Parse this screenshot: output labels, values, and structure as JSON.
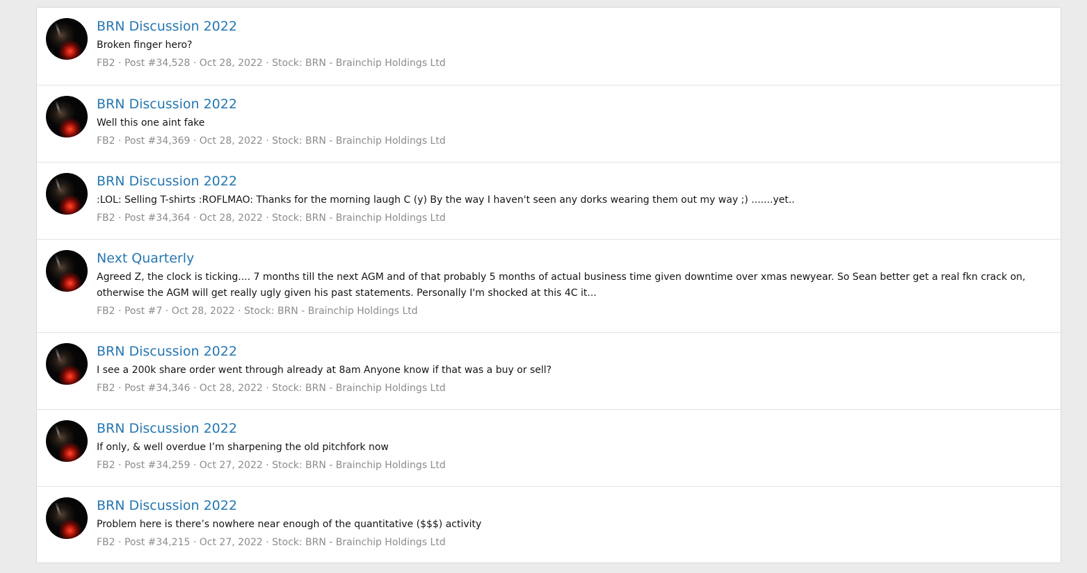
{
  "results": [
    {
      "title": "BRN Discussion 2022",
      "snippet": "Broken finger hero?",
      "author": "FB2",
      "post": "Post #34,528",
      "date": "Oct 28, 2022",
      "forum": "Stock: BRN - Brainchip Holdings Ltd"
    },
    {
      "title": "BRN Discussion 2022",
      "snippet": "Well this one aint fake",
      "author": "FB2",
      "post": "Post #34,369",
      "date": "Oct 28, 2022",
      "forum": "Stock: BRN - Brainchip Holdings Ltd"
    },
    {
      "title": "BRN Discussion 2022",
      "snippet": ":LOL: Selling T-shirts :ROFLMAO: Thanks for the morning laugh C (y) By the way I haven't seen any dorks wearing them out my way ;) .......yet..",
      "author": "FB2",
      "post": "Post #34,364",
      "date": "Oct 28, 2022",
      "forum": "Stock: BRN - Brainchip Holdings Ltd"
    },
    {
      "title": "Next Quarterly",
      "snippet": "Agreed Z, the clock is ticking.... 7 months till the next AGM and of that probably 5 months of actual business time given downtime over xmas newyear. So Sean better get a real fkn crack on, otherwise the AGM will get really ugly given his past statements. Personally I'm shocked at this 4C it...",
      "author": "FB2",
      "post": "Post #7",
      "date": "Oct 28, 2022",
      "forum": "Stock: BRN - Brainchip Holdings Ltd"
    },
    {
      "title": "BRN Discussion 2022",
      "snippet": "I see a 200k share order went through already at 8am Anyone know if that was a buy or sell?",
      "author": "FB2",
      "post": "Post #34,346",
      "date": "Oct 28, 2022",
      "forum": "Stock: BRN - Brainchip Holdings Ltd"
    },
    {
      "title": "BRN Discussion 2022",
      "snippet": "If only, & well overdue I’m sharpening the old pitchfork now",
      "author": "FB2",
      "post": "Post #34,259",
      "date": "Oct 27, 2022",
      "forum": "Stock: BRN - Brainchip Holdings Ltd"
    },
    {
      "title": "BRN Discussion 2022",
      "snippet": "Problem here is there’s nowhere near enough of the quantitative ($$$) activity",
      "author": "FB2",
      "post": "Post #34,215",
      "date": "Oct 27, 2022",
      "forum": "Stock: BRN - Brainchip Holdings Ltd"
    }
  ],
  "meta_separator": " · ",
  "colors": {
    "link": "#2577b1",
    "meta": "#8c8c8c",
    "background": "#ebebeb"
  },
  "icons": {
    "avatar": "user-avatar"
  }
}
